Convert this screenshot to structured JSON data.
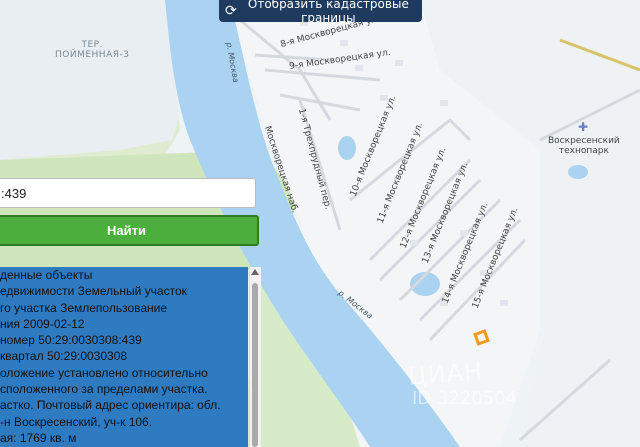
{
  "toolbar": {
    "cadastral_label": "Отобразить кадастровые границы",
    "cadastral_icon": "refresh-icon"
  },
  "search": {
    "value": ":439",
    "find_label": "Найти"
  },
  "map": {
    "territory": [
      "ТЕР.",
      "ПОЙМЕННАЯ-3"
    ],
    "river_labels": [
      "р. Москва",
      "р. Москва"
    ],
    "streets": [
      "8-я Москворецкая ул.",
      "9-я Москворецкая ул.",
      "1-я Трехпрудный пер.",
      "Москворецкая наб.",
      "10-я Москворецкая ул.",
      "11-я Москворецкая ул.",
      "12-я Москворецкая ул.",
      "13-я Москворецкая ул.",
      "14-я Москворецкая ул.",
      "15-я Москворецкая ул."
    ],
    "poi": [
      "Воскресенский",
      "технопарк"
    ],
    "watermark": [
      "ЦИАН",
      "ID 3220504"
    ]
  },
  "results": {
    "lines": [
      {
        "k": "денные объекты",
        "v": ""
      },
      {
        "k": "едвижимости",
        "v": " Земельный участок"
      },
      {
        "k": "го участка",
        "v": " Землепользование"
      },
      {
        "k": "ния",
        "v": " 2009-02-12"
      },
      {
        "k": "номер",
        "v": " 50:29:0030308:439"
      },
      {
        "k": "квартал",
        "v": " 50:29:0030308"
      },
      {
        "k": "оложение установлено относительно",
        "v": ""
      },
      {
        "k": "сположенного за пределами участка.",
        "v": ""
      },
      {
        "k": "астко. Почтовый адрес ориентира: обл.",
        "v": ""
      },
      {
        "k": "-н Воскресенский, уч-к 106.",
        "v": ""
      },
      {
        "k": "ая: 1769 кв. м",
        "v": ""
      }
    ]
  },
  "colors": {
    "button_bg": "#1e3a5f",
    "find_bg": "#4caf3d",
    "panel_bg": "#2f7bc2",
    "marker": "#f39a1e"
  }
}
